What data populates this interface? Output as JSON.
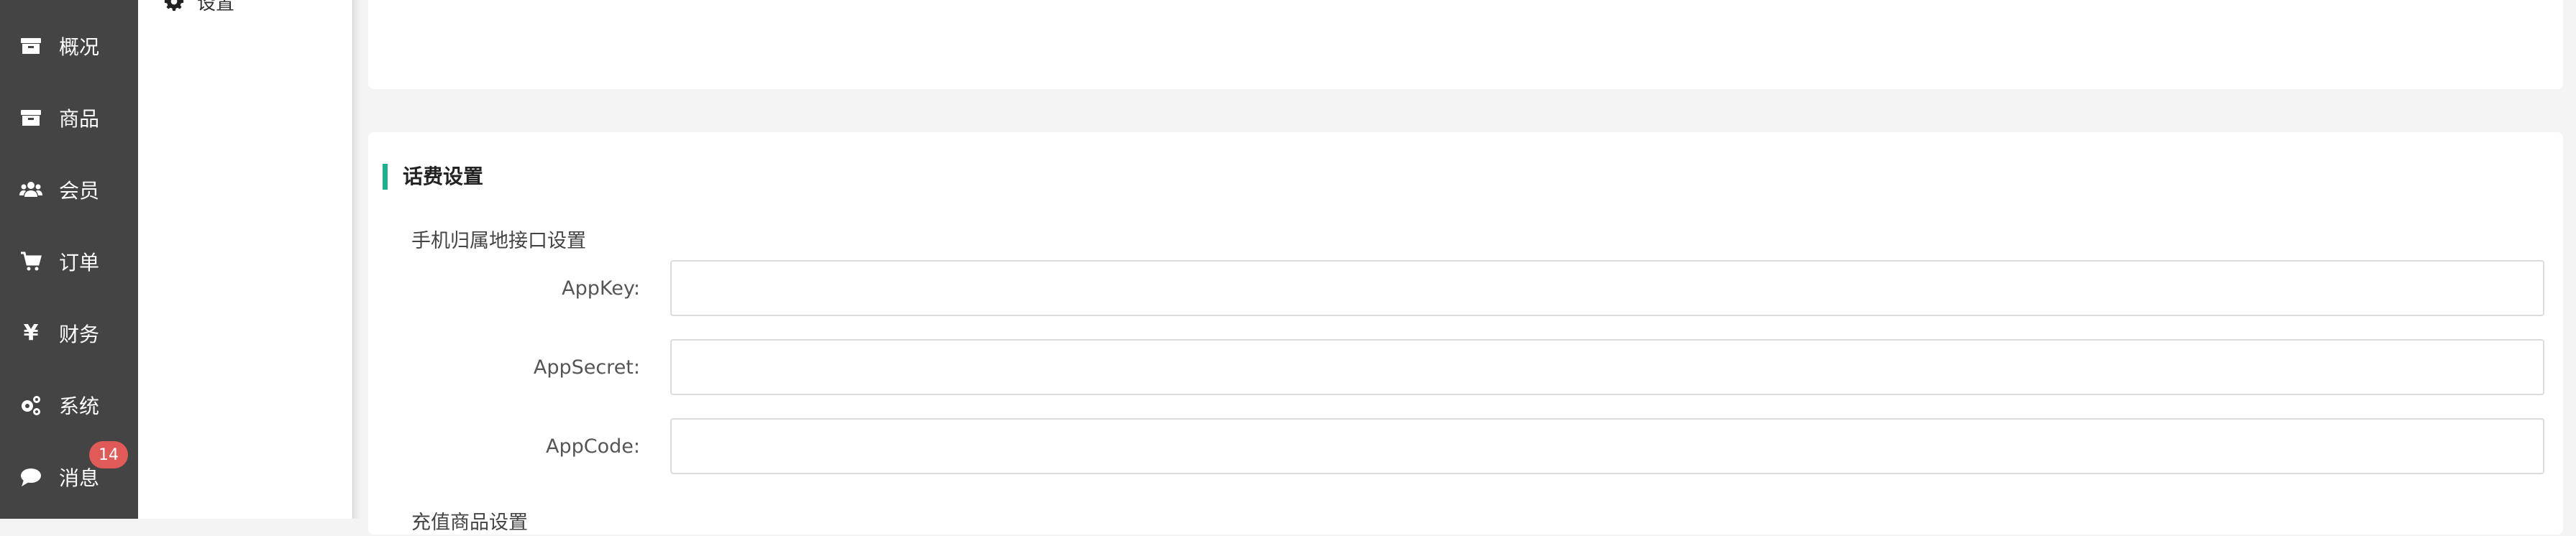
{
  "sidebar": {
    "items": [
      {
        "label": "概况",
        "icon": "archive-icon"
      },
      {
        "label": "商品",
        "icon": "archive-icon"
      },
      {
        "label": "会员",
        "icon": "users-icon"
      },
      {
        "label": "订单",
        "icon": "cart-icon"
      },
      {
        "label": "财务",
        "icon": "yen-icon",
        "glyph": "¥"
      },
      {
        "label": "系统",
        "icon": "gears-icon"
      },
      {
        "label": "消息",
        "icon": "comment-icon",
        "badge": "14"
      }
    ]
  },
  "submenu": {
    "item": {
      "label": "设置",
      "icon": "gear-icon"
    }
  },
  "section": {
    "title": "话费设置",
    "accent_color": "#19b28c",
    "subsection_title": "手机归属地接口设置",
    "fields": [
      {
        "label": "AppKey:",
        "value": "",
        "placeholder": ""
      },
      {
        "label": "AppSecret:",
        "value": "",
        "placeholder": ""
      },
      {
        "label": "AppCode:",
        "value": "",
        "placeholder": ""
      }
    ],
    "next_subsection_title": "充值商品设置"
  },
  "colors": {
    "sidebar_bg": "#444444",
    "badge_bg": "#e05a57",
    "page_bg": "#f4f4f4"
  }
}
